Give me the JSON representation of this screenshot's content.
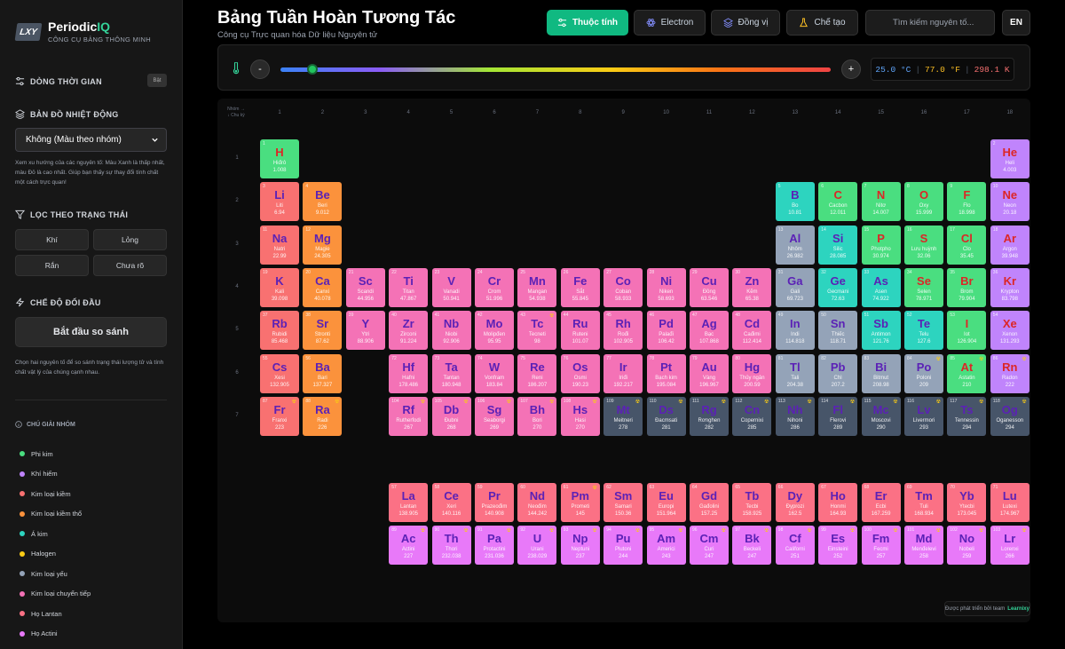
{
  "app": {
    "logo_badge": "LXY",
    "logo_name": "Periodic",
    "logo_accent": "IQ",
    "logo_sub": "CÔNG CỤ BẢNG THÔNG MINH"
  },
  "sidebar": {
    "timeline_label": "DÒNG THỜI GIAN",
    "timeline_toggle": "Bật",
    "heatmap_label": "BẢN ĐỒ NHIỆT ĐỘNG",
    "heatmap_select": "Không (Màu theo nhóm)",
    "heatmap_help": "Xem xu hướng của các nguyên tố: Màu Xanh là thấp nhất, màu Đỏ là cao nhất. Giúp bạn thấy sự thay đổi tính chất một cách trực quan!",
    "filter_label": "LỌC THEO TRẠNG THÁI",
    "filters": [
      "Khí",
      "Lỏng",
      "Rắn",
      "Chưa rõ"
    ],
    "compare_label": "CHẾ ĐỘ ĐỐI ĐẦU",
    "compare_button": "Bắt đầu so sánh",
    "compare_help": "Chọn hai nguyên tố để so sánh trạng thái lượng tử và tính chất vật lý của chúng cạnh nhau.",
    "legend_title": "CHÚ GIẢI NHÓM",
    "legend": [
      {
        "label": "Phi kim",
        "color": "#4ade80"
      },
      {
        "label": "Khí hiếm",
        "color": "#c084fc"
      },
      {
        "label": "Kim loại kiềm",
        "color": "#f87171"
      },
      {
        "label": "Kim loại kiềm thổ",
        "color": "#fb923c"
      },
      {
        "label": "Á kim",
        "color": "#2dd4bf"
      },
      {
        "label": "Halogen",
        "color": "#facc15"
      },
      {
        "label": "Kim loại yếu",
        "color": "#94a3b8"
      },
      {
        "label": "Kim loại chuyển tiếp",
        "color": "#f472b6"
      },
      {
        "label": "Họ Lantan",
        "color": "#fb7185"
      },
      {
        "label": "Họ Actini",
        "color": "#e879f9"
      }
    ]
  },
  "header": {
    "title": "Bảng Tuần Hoàn Tương Tác",
    "subtitle": "Công cụ Trực quan hóa Dữ liệu Nguyên tử",
    "tabs": [
      "Thuộc tính",
      "Electron",
      "Đồng vị",
      "Chế tạo"
    ],
    "search_placeholder": "Tìm kiếm nguyên tố...",
    "lang": "EN"
  },
  "temperature": {
    "minus": "-",
    "plus": "+",
    "celsius": "25.0 °C",
    "fahrenheit": "77.0 °F",
    "kelvin": "298.1 K",
    "slider_fraction": 0.058
  },
  "table": {
    "corner_top": "Nhóm →",
    "corner_bottom": "↓ Chu kỳ",
    "groups": [
      "1",
      "2",
      "3",
      "4",
      "5",
      "6",
      "7",
      "8",
      "9",
      "10",
      "11",
      "12",
      "13",
      "14",
      "15",
      "16",
      "17",
      "18"
    ],
    "periods": [
      "1",
      "2",
      "3",
      "4",
      "5",
      "6",
      "7"
    ],
    "elements": [
      [
        1,
        "H",
        "Hiđrô",
        "1.008",
        1,
        1,
        "nonmetal"
      ],
      [
        2,
        "He",
        "Heli",
        "4.003",
        18,
        1,
        "noble"
      ],
      [
        3,
        "Li",
        "Liti",
        "6.94",
        1,
        2,
        "alkali"
      ],
      [
        4,
        "Be",
        "Beri",
        "9.012",
        2,
        2,
        "alkaline"
      ],
      [
        5,
        "B",
        "Bo",
        "10.81",
        13,
        2,
        "metalloid"
      ],
      [
        6,
        "C",
        "Cacbon",
        "12.011",
        14,
        2,
        "nonmetal"
      ],
      [
        7,
        "N",
        "Nitơ",
        "14.007",
        15,
        2,
        "nonmetal"
      ],
      [
        8,
        "O",
        "Oxy",
        "15.999",
        16,
        2,
        "nonmetal"
      ],
      [
        9,
        "F",
        "Flo",
        "18.998",
        17,
        2,
        "halogen"
      ],
      [
        10,
        "Ne",
        "Neon",
        "20.18",
        18,
        2,
        "noble"
      ],
      [
        11,
        "Na",
        "Natri",
        "22.99",
        1,
        3,
        "alkali"
      ],
      [
        12,
        "Mg",
        "Magie",
        "24.305",
        2,
        3,
        "alkaline"
      ],
      [
        13,
        "Al",
        "Nhôm",
        "26.982",
        13,
        3,
        "post"
      ],
      [
        14,
        "Si",
        "Silic",
        "28.085",
        14,
        3,
        "metalloid"
      ],
      [
        15,
        "P",
        "Photpho",
        "30.974",
        15,
        3,
        "nonmetal"
      ],
      [
        16,
        "S",
        "Lưu huỳnh",
        "32.06",
        16,
        3,
        "nonmetal"
      ],
      [
        17,
        "Cl",
        "Clo",
        "35.45",
        17,
        3,
        "halogen"
      ],
      [
        18,
        "Ar",
        "Argon",
        "39.948",
        18,
        3,
        "noble"
      ],
      [
        19,
        "K",
        "Kali",
        "39.098",
        1,
        4,
        "alkali"
      ],
      [
        20,
        "Ca",
        "Canxi",
        "40.078",
        2,
        4,
        "alkaline"
      ],
      [
        21,
        "Sc",
        "Scandi",
        "44.956",
        3,
        4,
        "transition"
      ],
      [
        22,
        "Ti",
        "Titan",
        "47.867",
        4,
        4,
        "transition"
      ],
      [
        23,
        "V",
        "Vanadi",
        "50.941",
        5,
        4,
        "transition"
      ],
      [
        24,
        "Cr",
        "Crom",
        "51.996",
        6,
        4,
        "transition"
      ],
      [
        25,
        "Mn",
        "Mangan",
        "54.938",
        7,
        4,
        "transition"
      ],
      [
        26,
        "Fe",
        "Sắt",
        "55.845",
        8,
        4,
        "transition"
      ],
      [
        27,
        "Co",
        "Coban",
        "58.933",
        9,
        4,
        "transition"
      ],
      [
        28,
        "Ni",
        "Niken",
        "58.693",
        10,
        4,
        "transition"
      ],
      [
        29,
        "Cu",
        "Đồng",
        "63.546",
        11,
        4,
        "transition"
      ],
      [
        30,
        "Zn",
        "Kẽm",
        "65.38",
        12,
        4,
        "transition"
      ],
      [
        31,
        "Ga",
        "Gali",
        "69.723",
        13,
        4,
        "post"
      ],
      [
        32,
        "Ge",
        "Gecmani",
        "72.63",
        14,
        4,
        "metalloid"
      ],
      [
        33,
        "As",
        "Asen",
        "74.922",
        15,
        4,
        "metalloid"
      ],
      [
        34,
        "Se",
        "Selen",
        "78.971",
        16,
        4,
        "nonmetal"
      ],
      [
        35,
        "Br",
        "Brom",
        "79.904",
        17,
        4,
        "halogen"
      ],
      [
        36,
        "Kr",
        "Krypton",
        "83.798",
        18,
        4,
        "noble"
      ],
      [
        37,
        "Rb",
        "Rubidi",
        "85.468",
        1,
        5,
        "alkali"
      ],
      [
        38,
        "Sr",
        "Stronti",
        "87.62",
        2,
        5,
        "alkaline"
      ],
      [
        39,
        "Y",
        "Ytri",
        "88.906",
        3,
        5,
        "transition"
      ],
      [
        40,
        "Zr",
        "Zirconi",
        "91.224",
        4,
        5,
        "transition"
      ],
      [
        41,
        "Nb",
        "Niobi",
        "92.906",
        5,
        5,
        "transition"
      ],
      [
        42,
        "Mo",
        "Molipđen",
        "95.95",
        6,
        5,
        "transition"
      ],
      [
        43,
        "Tc",
        "Tecneti",
        "98",
        7,
        5,
        "transition"
      ],
      [
        44,
        "Ru",
        "Ruteni",
        "101.07",
        8,
        5,
        "transition"
      ],
      [
        45,
        "Rh",
        "Rođi",
        "102.905",
        9,
        5,
        "transition"
      ],
      [
        46,
        "Pd",
        "Palađi",
        "106.42",
        10,
        5,
        "transition"
      ],
      [
        47,
        "Ag",
        "Bạc",
        "107.868",
        11,
        5,
        "transition"
      ],
      [
        48,
        "Cd",
        "Cađimi",
        "112.414",
        12,
        5,
        "transition"
      ],
      [
        49,
        "In",
        "Indi",
        "114.818",
        13,
        5,
        "post"
      ],
      [
        50,
        "Sn",
        "Thiếc",
        "118.71",
        14,
        5,
        "post"
      ],
      [
        51,
        "Sb",
        "Antimon",
        "121.76",
        15,
        5,
        "metalloid"
      ],
      [
        52,
        "Te",
        "Telu",
        "127.6",
        16,
        5,
        "metalloid"
      ],
      [
        53,
        "I",
        "Iot",
        "126.904",
        17,
        5,
        "halogen"
      ],
      [
        54,
        "Xe",
        "Xenon",
        "131.293",
        18,
        5,
        "noble"
      ],
      [
        55,
        "Cs",
        "Xesi",
        "132.905",
        1,
        6,
        "alkali"
      ],
      [
        56,
        "Ba",
        "Bari",
        "137.327",
        2,
        6,
        "alkaline"
      ],
      [
        72,
        "Hf",
        "Hafni",
        "178.486",
        4,
        6,
        "transition"
      ],
      [
        73,
        "Ta",
        "Tantan",
        "180.948",
        5,
        6,
        "transition"
      ],
      [
        74,
        "W",
        "Vonfram",
        "183.84",
        6,
        6,
        "transition"
      ],
      [
        75,
        "Re",
        "Reni",
        "186.207",
        7,
        6,
        "transition"
      ],
      [
        76,
        "Os",
        "Osmi",
        "190.23",
        8,
        6,
        "transition"
      ],
      [
        77,
        "Ir",
        "Iriđi",
        "192.217",
        9,
        6,
        "transition"
      ],
      [
        78,
        "Pt",
        "Bạch kim",
        "195.084",
        10,
        6,
        "transition"
      ],
      [
        79,
        "Au",
        "Vàng",
        "196.967",
        11,
        6,
        "transition"
      ],
      [
        80,
        "Hg",
        "Thủy ngân",
        "200.59",
        12,
        6,
        "transition"
      ],
      [
        81,
        "Tl",
        "Tali",
        "204.38",
        13,
        6,
        "post"
      ],
      [
        82,
        "Pb",
        "Chì",
        "207.2",
        14,
        6,
        "post"
      ],
      [
        83,
        "Bi",
        "Bitmut",
        "208.98",
        15,
        6,
        "post"
      ],
      [
        84,
        "Po",
        "Poloni",
        "209",
        16,
        6,
        "post"
      ],
      [
        85,
        "At",
        "Astatin",
        "210",
        17,
        6,
        "halogen"
      ],
      [
        86,
        "Rn",
        "Radon",
        "222",
        18,
        6,
        "noble"
      ],
      [
        87,
        "Fr",
        "Franxi",
        "223",
        1,
        7,
        "alkali"
      ],
      [
        88,
        "Ra",
        "Radi",
        "226",
        2,
        7,
        "alkaline"
      ],
      [
        104,
        "Rf",
        "Rutherfodi",
        "267",
        4,
        7,
        "transition"
      ],
      [
        105,
        "Db",
        "Đubni",
        "268",
        5,
        7,
        "transition"
      ],
      [
        106,
        "Sg",
        "Seaborgi",
        "269",
        6,
        7,
        "transition"
      ],
      [
        107,
        "Bh",
        "Bori",
        "270",
        7,
        7,
        "transition"
      ],
      [
        108,
        "Hs",
        "Hasi",
        "270",
        8,
        7,
        "transition"
      ],
      [
        109,
        "Mt",
        "Meitneri",
        "278",
        9,
        7,
        "unknown"
      ],
      [
        110,
        "Ds",
        "Đacmsati",
        "281",
        10,
        7,
        "unknown"
      ],
      [
        111,
        "Rg",
        "Rơnghen",
        "282",
        11,
        7,
        "unknown"
      ],
      [
        112,
        "Cn",
        "Copernixi",
        "285",
        12,
        7,
        "unknown"
      ],
      [
        113,
        "Nh",
        "Nihoni",
        "286",
        13,
        7,
        "unknown"
      ],
      [
        114,
        "Fl",
        "Flerovi",
        "289",
        14,
        7,
        "unknown"
      ],
      [
        115,
        "Mc",
        "Moscovi",
        "290",
        15,
        7,
        "unknown"
      ],
      [
        116,
        "Lv",
        "Livermori",
        "293",
        16,
        7,
        "unknown"
      ],
      [
        117,
        "Ts",
        "Tennessin",
        "294",
        17,
        7,
        "unknown"
      ],
      [
        118,
        "Og",
        "Oganesson",
        "294",
        18,
        7,
        "unknown"
      ],
      [
        57,
        "La",
        "Lantan",
        "138.905",
        4,
        9,
        "lanthanide"
      ],
      [
        58,
        "Ce",
        "Xeri",
        "140.116",
        5,
        9,
        "lanthanide"
      ],
      [
        59,
        "Pr",
        "Prazeođim",
        "140.908",
        6,
        9,
        "lanthanide"
      ],
      [
        60,
        "Nd",
        "Neođim",
        "144.242",
        7,
        9,
        "lanthanide"
      ],
      [
        61,
        "Pm",
        "Prometi",
        "145",
        8,
        9,
        "lanthanide"
      ],
      [
        62,
        "Sm",
        "Samari",
        "150.36",
        9,
        9,
        "lanthanide"
      ],
      [
        63,
        "Eu",
        "Europi",
        "151.964",
        10,
        9,
        "lanthanide"
      ],
      [
        64,
        "Gd",
        "Gađolini",
        "157.25",
        11,
        9,
        "lanthanide"
      ],
      [
        65,
        "Tb",
        "Tecbi",
        "158.925",
        12,
        9,
        "lanthanide"
      ],
      [
        66,
        "Dy",
        "Đyprozi",
        "162.5",
        13,
        9,
        "lanthanide"
      ],
      [
        67,
        "Ho",
        "Honmi",
        "164.93",
        14,
        9,
        "lanthanide"
      ],
      [
        68,
        "Er",
        "Ecbi",
        "167.259",
        15,
        9,
        "lanthanide"
      ],
      [
        69,
        "Tm",
        "Tuli",
        "168.934",
        16,
        9,
        "lanthanide"
      ],
      [
        70,
        "Yb",
        "Ytecbi",
        "173.045",
        17,
        9,
        "lanthanide"
      ],
      [
        71,
        "Lu",
        "Lutexi",
        "174.967",
        18,
        9,
        "lanthanide"
      ],
      [
        89,
        "Ac",
        "Actini",
        "227",
        4,
        10,
        "actinide"
      ],
      [
        90,
        "Th",
        "Thori",
        "232.038",
        5,
        10,
        "actinide"
      ],
      [
        91,
        "Pa",
        "Protactini",
        "231.036",
        6,
        10,
        "actinide"
      ],
      [
        92,
        "U",
        "Urani",
        "238.029",
        7,
        10,
        "actinide"
      ],
      [
        93,
        "Np",
        "Neptuni",
        "237",
        8,
        10,
        "actinide"
      ],
      [
        94,
        "Pu",
        "Plutoni",
        "244",
        9,
        10,
        "actinide"
      ],
      [
        95,
        "Am",
        "Americi",
        "243",
        10,
        10,
        "actinide"
      ],
      [
        96,
        "Cm",
        "Curi",
        "247",
        11,
        10,
        "actinide"
      ],
      [
        97,
        "Bk",
        "Beckeli",
        "247",
        12,
        10,
        "actinide"
      ],
      [
        98,
        "Cf",
        "Californi",
        "251",
        13,
        10,
        "actinide"
      ],
      [
        99,
        "Es",
        "Einsteini",
        "252",
        14,
        10,
        "actinide"
      ],
      [
        100,
        "Fm",
        "Fecmi",
        "257",
        15,
        10,
        "actinide"
      ],
      [
        101,
        "Md",
        "Menđelevi",
        "258",
        16,
        10,
        "actinide"
      ],
      [
        102,
        "No",
        "Nobeli",
        "259",
        17,
        10,
        "actinide"
      ],
      [
        103,
        "Lr",
        "Lorenxi",
        "266",
        18,
        10,
        "actinide"
      ]
    ],
    "radioactive": [
      43,
      61,
      84,
      85,
      86,
      87,
      88,
      89,
      90,
      91,
      92,
      93,
      94,
      95,
      96,
      97,
      98,
      99,
      100,
      101,
      102,
      103,
      104,
      105,
      106,
      107,
      108,
      109,
      110,
      111,
      112,
      113,
      114,
      115,
      116,
      117,
      118
    ],
    "radioactive_mark": "☢"
  },
  "colors": {
    "nonmetal": {
      "bg": "#4ade80",
      "sym": "#dc2626"
    },
    "noble": {
      "bg": "#c084fc",
      "sym": "#dc2626"
    },
    "alkali": {
      "bg": "#f87171",
      "sym": "#5b21b6"
    },
    "alkaline": {
      "bg": "#fb923c",
      "sym": "#5b21b6"
    },
    "metalloid": {
      "bg": "#2dd4bf",
      "sym": "#5b21b6"
    },
    "halogen": {
      "bg": "#4ade80",
      "sym": "#dc2626"
    },
    "post": {
      "bg": "#94a3b8",
      "sym": "#5b21b6"
    },
    "transition": {
      "bg": "#f472b6",
      "sym": "#5b21b6"
    },
    "lanthanide": {
      "bg": "#fb7185",
      "sym": "#5b21b6"
    },
    "actinide": {
      "bg": "#e879f9",
      "sym": "#5b21b6"
    },
    "unknown": {
      "bg": "#475569",
      "sym": "#5b21b6"
    }
  },
  "footer": {
    "text": "Được phát triển bởi team",
    "brand": "Learnixy"
  }
}
